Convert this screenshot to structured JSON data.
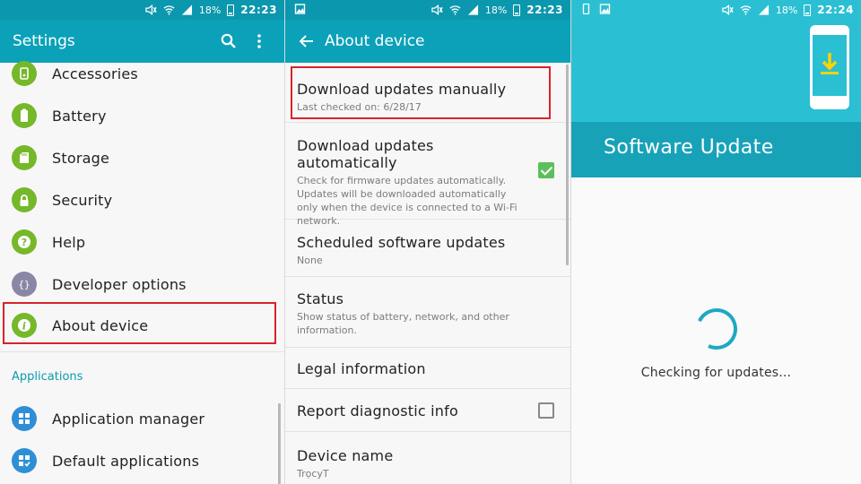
{
  "status_bars": [
    {
      "battery": "18%",
      "time": "22:23"
    },
    {
      "battery": "18%",
      "time": "22:23"
    },
    {
      "battery": "18%",
      "time": "22:24"
    }
  ],
  "settings": {
    "title": "Settings",
    "items": [
      {
        "label": "Accessories",
        "icon": "accessories-icon"
      },
      {
        "label": "Battery",
        "icon": "battery-icon"
      },
      {
        "label": "Storage",
        "icon": "storage-icon"
      },
      {
        "label": "Security",
        "icon": "lock-icon"
      },
      {
        "label": "Help",
        "icon": "help-icon"
      },
      {
        "label": "Developer options",
        "icon": "braces-icon"
      },
      {
        "label": "About device",
        "icon": "info-icon"
      }
    ],
    "section_applications": "Applications",
    "app_items": [
      {
        "label": "Application manager",
        "icon": "grid-icon"
      },
      {
        "label": "Default applications",
        "icon": "grid-check-icon"
      }
    ]
  },
  "about": {
    "title": "About device",
    "items": [
      {
        "title": "Download updates manually",
        "subtitle": "Last checked on: 6/28/17"
      },
      {
        "title": "Download updates automatically",
        "subtitle": "Check for firmware updates automatically. Updates will be downloaded automatically only when the device is connected to a Wi-Fi network.",
        "checked": true
      },
      {
        "title": "Scheduled software updates",
        "subtitle": "None"
      },
      {
        "title": "Status",
        "subtitle": "Show status of battery, network, and other information."
      },
      {
        "title": "Legal information"
      },
      {
        "title": "Report diagnostic info",
        "checked": false
      },
      {
        "title": "Device name",
        "subtitle": "TrọcyT"
      }
    ]
  },
  "software_update": {
    "title": "Software Update",
    "status": "Checking for updates..."
  },
  "colors": {
    "status_bar": "#0b97ad",
    "app_bar": "#0ba1b8",
    "accent": "#0a9bb2",
    "highlight": "#d8232a",
    "icon_green": "#76b82a",
    "icon_blue": "#2e8fd6",
    "icon_purple": "#8a86a6",
    "checkbox_on": "#5cbf5b"
  }
}
